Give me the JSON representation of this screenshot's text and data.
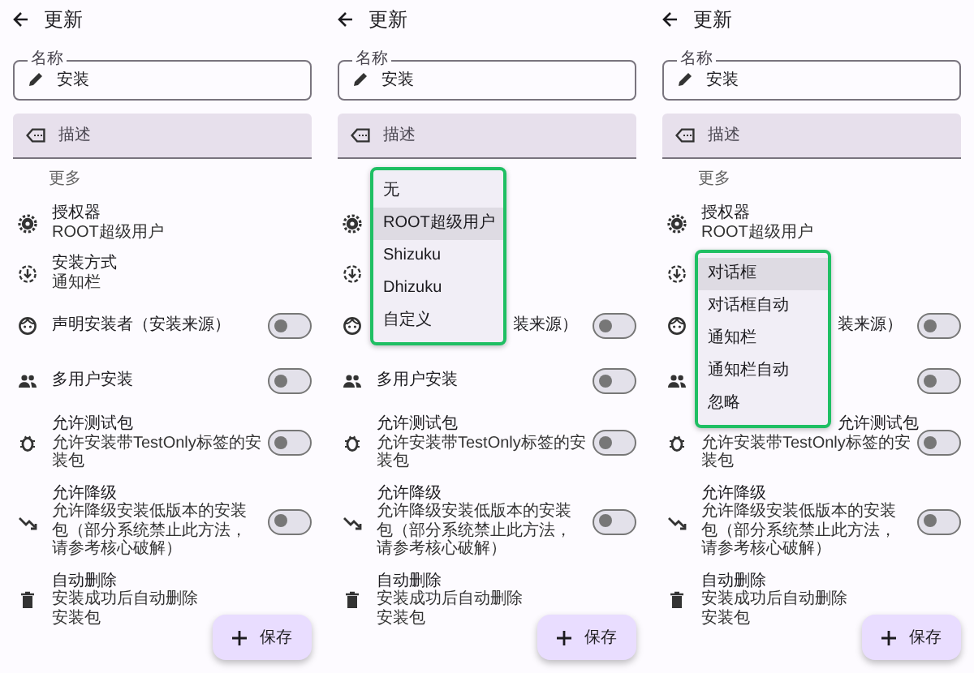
{
  "panels": [
    {
      "title": "更新",
      "name_field": {
        "label": "名称",
        "value": "安装"
      },
      "description_field": {
        "placeholder": "描述"
      },
      "section": "更多",
      "save_button": "保存",
      "settings": [
        {
          "kind": "option",
          "title": "授权器",
          "subtitle": "ROOT超级用户"
        },
        {
          "kind": "option",
          "title": "安装方式",
          "subtitle": "通知栏"
        },
        {
          "kind": "switch",
          "title": "声明安装者（安装来源）",
          "on": false
        },
        {
          "kind": "switch",
          "title": "多用户安装",
          "on": false
        },
        {
          "kind": "switch",
          "title": "允许测试包",
          "subtitle": "允许安装带TestOnly标签的安装包",
          "on": false
        },
        {
          "kind": "switch",
          "title": "允许降级",
          "subtitle": "允许降级安装低版本的安装包（部分系统禁止此方法，请参考核心破解）",
          "on": false
        },
        {
          "kind": "option",
          "title": "自动删除",
          "subtitle": "安装成功后自动删除安装包"
        }
      ]
    },
    {
      "title": "更新",
      "name_field": {
        "label": "名称",
        "value": "安装"
      },
      "description_field": {
        "placeholder": "描述"
      },
      "save_button": "保存",
      "settings": [
        {
          "kind": "option",
          "menu": {
            "items": [
              {
                "label": "无",
                "selected": false
              },
              {
                "label": "ROOT超级用户",
                "selected": true
              },
              {
                "label": "Shizuku",
                "selected": false
              },
              {
                "label": "Dhizuku",
                "selected": false
              },
              {
                "label": "自定义",
                "selected": false
              }
            ]
          }
        },
        {
          "kind": "option"
        },
        {
          "kind": "switch",
          "title": "装来源）",
          "on": false
        },
        {
          "kind": "switch",
          "title": "多用户安装",
          "on": false
        },
        {
          "kind": "switch",
          "title": "允许测试包",
          "subtitle": "允许安装带TestOnly标签的安装包",
          "on": false
        },
        {
          "kind": "switch",
          "title": "允许降级",
          "subtitle": "允许降级安装低版本的安装包（部分系统禁止此方法，请参考核心破解）",
          "on": false
        },
        {
          "kind": "option",
          "title": "自动删除",
          "subtitle": "安装成功后自动删除安装包"
        }
      ]
    },
    {
      "title": "更新",
      "name_field": {
        "label": "名称",
        "value": "安装"
      },
      "description_field": {
        "placeholder": "描述"
      },
      "section": "更多",
      "save_button": "保存",
      "settings": [
        {
          "kind": "option",
          "title": "授权器",
          "subtitle": "ROOT超级用户"
        },
        {
          "kind": "option",
          "menu": {
            "items": [
              {
                "label": "对话框",
                "selected": true
              },
              {
                "label": "对话框自动",
                "selected": false
              },
              {
                "label": "通知栏",
                "selected": false
              },
              {
                "label": "通知栏自动",
                "selected": false
              },
              {
                "label": "忽略",
                "selected": false
              }
            ]
          }
        },
        {
          "kind": "switch",
          "title": "装来源）",
          "on": false
        },
        {
          "kind": "switch",
          "on": false
        },
        {
          "kind": "switch",
          "title": "允许测试包",
          "subtitle": "允许安装带TestOnly标签的安装包",
          "on": false
        },
        {
          "kind": "switch",
          "title": "允许降级",
          "subtitle": "允许降级安装低版本的安装包（部分系统禁止此方法，请参考核心破解）",
          "on": false
        },
        {
          "kind": "option",
          "title": "自动删除",
          "subtitle": "安装成功后自动删除安装包"
        }
      ]
    }
  ]
}
